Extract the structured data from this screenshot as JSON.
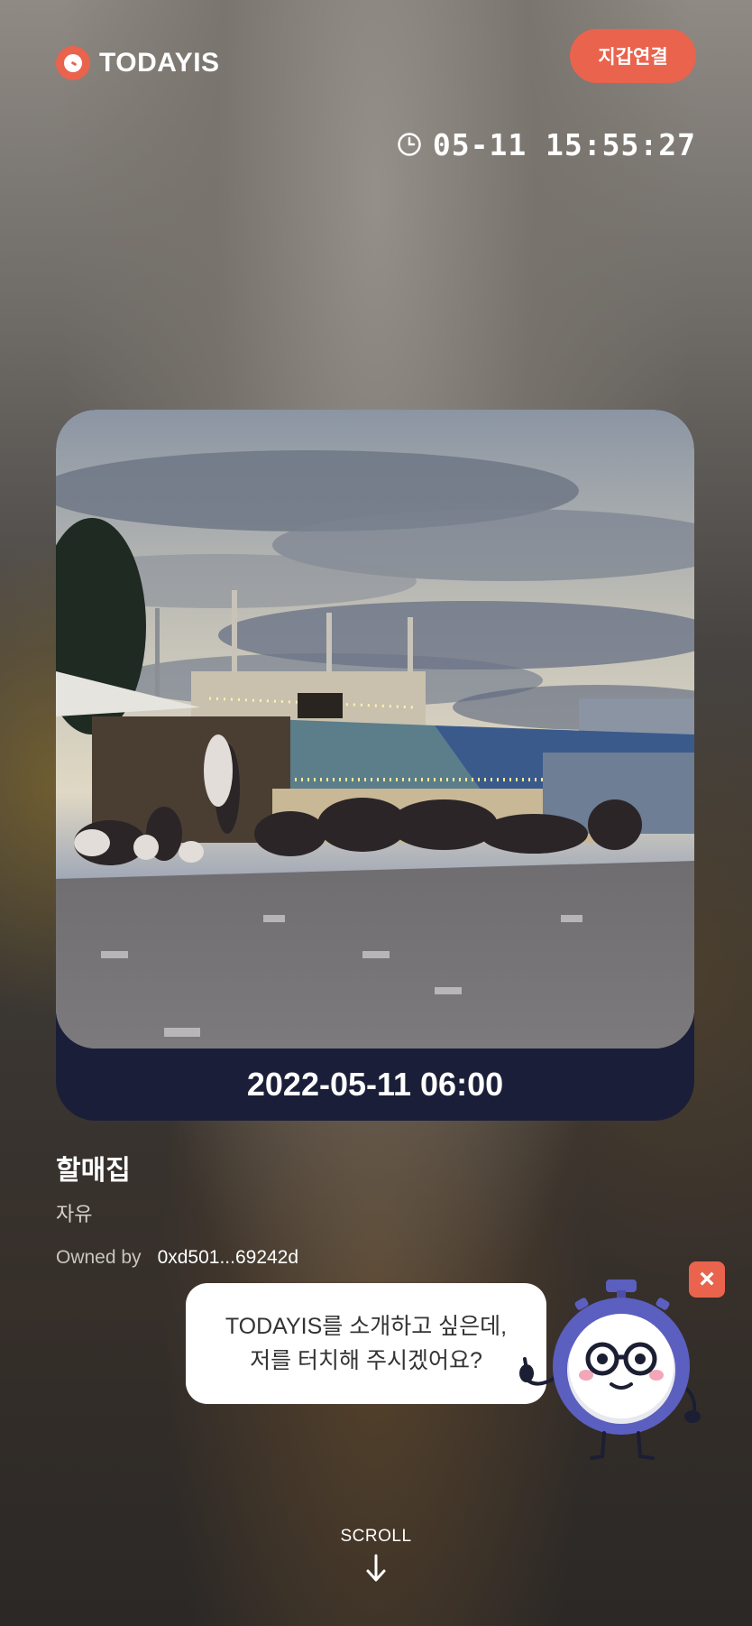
{
  "header": {
    "logo_text": "TODAYIS",
    "wallet_button": "지갑연결"
  },
  "clock": {
    "time_text": "05-11 15:55:27",
    "icon": "clock-icon"
  },
  "card": {
    "date_text": "2022-05-11 06:00",
    "image_description_icon": "photo-image"
  },
  "info": {
    "title": "할매집",
    "subtitle": "자유",
    "owned_label": "Owned by",
    "owned_address": "0xd501...69242d"
  },
  "promo": {
    "line1": "TODAYIS를 소개하고 싶은데,",
    "line2": "저를 터치해 주시겠어요?",
    "close_icon": "close-icon",
    "mascot_icon": "stopwatch-mascot-icon"
  },
  "scroll": {
    "label": "SCROLL",
    "icon": "arrow-down-icon"
  },
  "colors": {
    "accent": "#e9634d",
    "card_bg": "#1b1e38",
    "mascot": "#5b5fbf"
  }
}
